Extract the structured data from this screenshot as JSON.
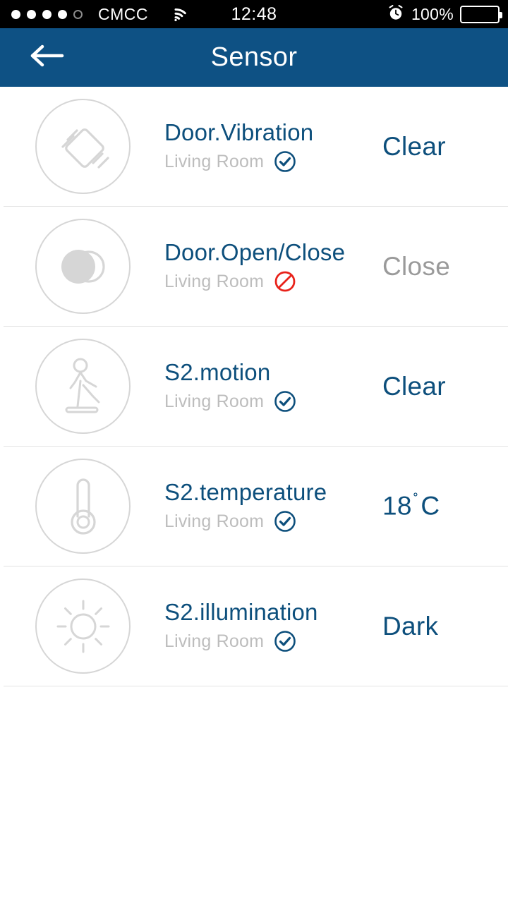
{
  "status_bar": {
    "signal_dots_filled": 4,
    "signal_dots_total": 5,
    "carrier": "CMCC",
    "wifi_icon": "wifi-icon",
    "time": "12:48",
    "alarm_icon": "alarm-clock-icon",
    "battery_percent": "100%",
    "battery_icon": "battery-full-icon"
  },
  "header": {
    "back_icon": "back-arrow-icon",
    "title": "Sensor",
    "background_color": "#0e5184"
  },
  "colors": {
    "accent_blue": "#0d4f7c",
    "header_blue": "#0e5184",
    "muted_gray": "#9a9a9a",
    "room_gray": "#bdbdbd",
    "icon_gray": "#d6d6d6",
    "divider": "#e3e3e3",
    "offline_red": "#e8221a"
  },
  "sensors": [
    {
      "name": "Door.Vibration",
      "room": "Living Room",
      "status_icon": "check-circle-icon",
      "online": true,
      "value": "Clear",
      "value_state": "ok",
      "icon": "vibration-icon"
    },
    {
      "name": "Door.Open/Close",
      "room": "Living Room",
      "status_icon": "prohibited-icon",
      "online": false,
      "value": "Close",
      "value_state": "off",
      "icon": "door-contact-icon"
    },
    {
      "name": "S2.motion",
      "room": "Living Room",
      "status_icon": "check-circle-icon",
      "online": true,
      "value": "Clear",
      "value_state": "ok",
      "icon": "motion-walking-icon"
    },
    {
      "name": "S2.temperature",
      "room": "Living Room",
      "status_icon": "check-circle-icon",
      "online": true,
      "value": "18",
      "value_unit": "C",
      "value_degree": "˚",
      "value_state": "ok",
      "icon": "thermometer-icon"
    },
    {
      "name": "S2.illumination",
      "room": "Living Room",
      "status_icon": "check-circle-icon",
      "online": true,
      "value": "Dark",
      "value_state": "ok",
      "icon": "brightness-sun-icon"
    }
  ]
}
